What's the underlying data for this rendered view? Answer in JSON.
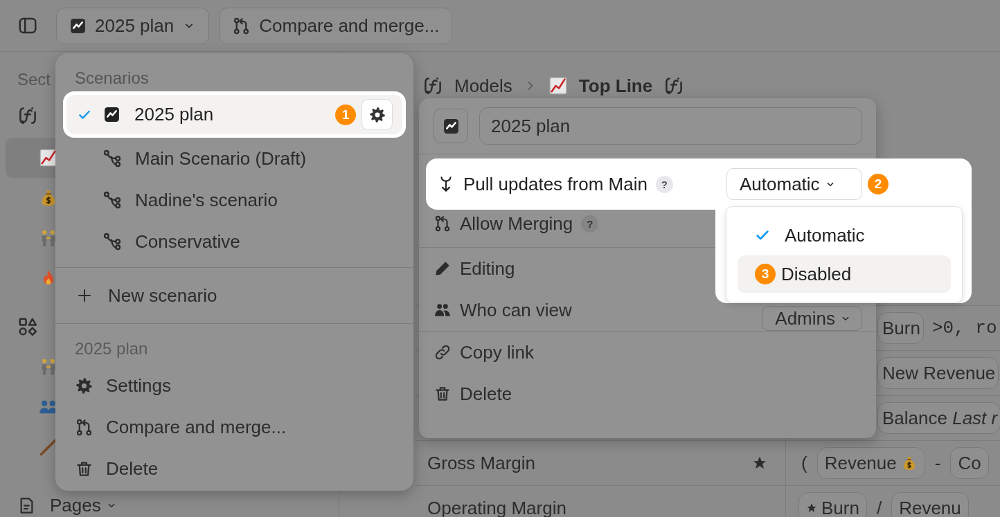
{
  "toolbar": {
    "scenario_button": "2025 plan",
    "compare_button": "Compare and merge..."
  },
  "sidebar": {
    "heading": "Sect",
    "groups": [
      {
        "items": [
          {
            "selected": true
          },
          {
            "selected": false
          },
          {
            "selected": false
          },
          {
            "selected": false
          }
        ]
      },
      {
        "items": [
          {
            "selected": false
          },
          {
            "selected": false
          },
          {
            "selected": false
          }
        ]
      }
    ],
    "pages_label": "Pages"
  },
  "breadcrumb": {
    "parent": "Models",
    "current": "Top Line"
  },
  "table": {
    "rows": [
      {
        "formula": [
          {
            "kind": "token",
            "text": "Burn"
          },
          {
            "kind": "code",
            "text": ">0, ro"
          }
        ]
      },
      {
        "formula": [
          {
            "kind": "token",
            "text": "New Revenue"
          }
        ]
      },
      {
        "formula": [
          {
            "kind": "token",
            "text": "Balance *Last r*"
          }
        ]
      },
      {
        "name": "Gross Margin",
        "starred": true,
        "formula": [
          {
            "kind": "text",
            "text": "("
          },
          {
            "kind": "token",
            "text": "Revenue",
            "emoji": true
          },
          {
            "kind": "text",
            "text": "-"
          },
          {
            "kind": "token",
            "text": "Co"
          }
        ]
      },
      {
        "name": "Operating Margin",
        "starred": false,
        "formula": [
          {
            "kind": "token",
            "text": "Burn",
            "starred": true
          },
          {
            "kind": "text",
            "text": "/"
          },
          {
            "kind": "token",
            "text": "Revenu"
          }
        ]
      }
    ]
  },
  "scenario_menu": {
    "heading": "Scenarios",
    "scenarios": [
      {
        "label": "2025 plan",
        "kind": "plan",
        "selected": true,
        "badge": "1"
      },
      {
        "label": "Main Scenario (Draft)",
        "kind": "branch",
        "selected": false
      },
      {
        "label": "Nadine's scenario",
        "kind": "branch",
        "selected": false
      },
      {
        "label": "Conservative",
        "kind": "branch",
        "selected": false
      }
    ],
    "new_scenario": "New scenario",
    "section_heading": "2025 plan",
    "actions": [
      {
        "label": "Settings"
      },
      {
        "label": "Compare and merge..."
      },
      {
        "label": "Delete"
      }
    ]
  },
  "settings_panel": {
    "name_value": "2025 plan",
    "groups": [
      {
        "rows": [
          {
            "label": "Pull updates from Main",
            "help": "?",
            "value": "Automatic",
            "highlighted": true,
            "badge": "2"
          },
          {
            "label": "Allow Merging",
            "help": "?",
            "highlighted": false
          }
        ]
      },
      {
        "rows": [
          {
            "label": "Editing",
            "highlighted": false
          },
          {
            "label": "Who can view",
            "value": "Admins",
            "highlighted": false
          }
        ]
      },
      {
        "rows": [
          {
            "label": "Copy link",
            "highlighted": false
          },
          {
            "label": "Delete",
            "highlighted": false
          }
        ]
      }
    ],
    "dropdown": {
      "options": [
        {
          "label": "Automatic",
          "selected": true,
          "hovered": false
        },
        {
          "label": "Disabled",
          "selected": false,
          "hovered": true,
          "badge": "3"
        }
      ]
    }
  }
}
